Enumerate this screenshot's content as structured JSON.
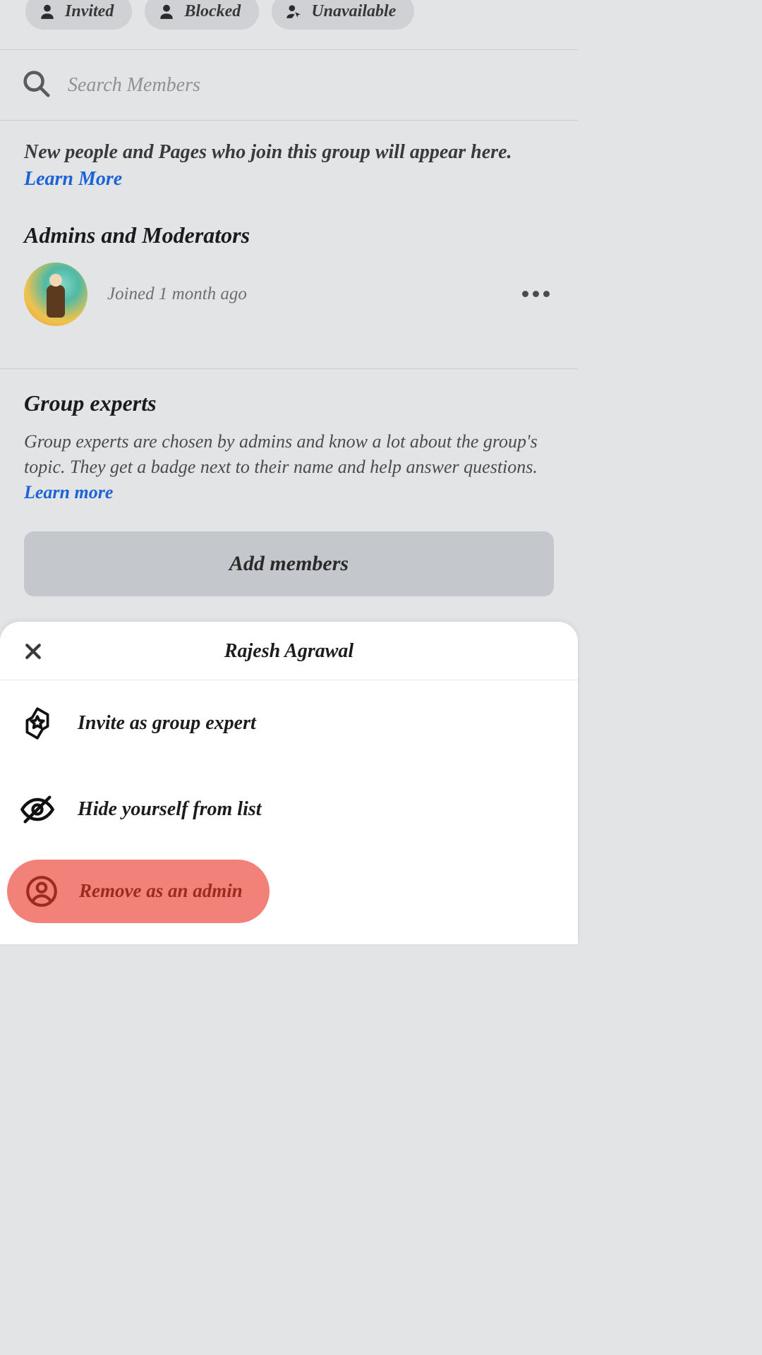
{
  "chips": {
    "invited": "Invited",
    "blocked": "Blocked",
    "unavailable": "Unavailable"
  },
  "search": {
    "placeholder": "Search Members",
    "value": ""
  },
  "info": {
    "text_a": "New people and Pages who join this group will appear here. ",
    "learn_more": "Learn More"
  },
  "admins": {
    "heading": "Admins and Moderators",
    "member_sub": "Joined 1 month ago"
  },
  "experts": {
    "heading": "Group experts",
    "body": "Group experts are chosen by admins and know a lot about the group's topic. They get a badge next to their name and help answer questions. ",
    "learn_more": "Learn more",
    "add_button": "Add members"
  },
  "sheet": {
    "title": "Rajesh Agrawal",
    "item_invite": "Invite as group expert",
    "item_hide": "Hide yourself from list",
    "item_remove": "Remove as an admin"
  }
}
